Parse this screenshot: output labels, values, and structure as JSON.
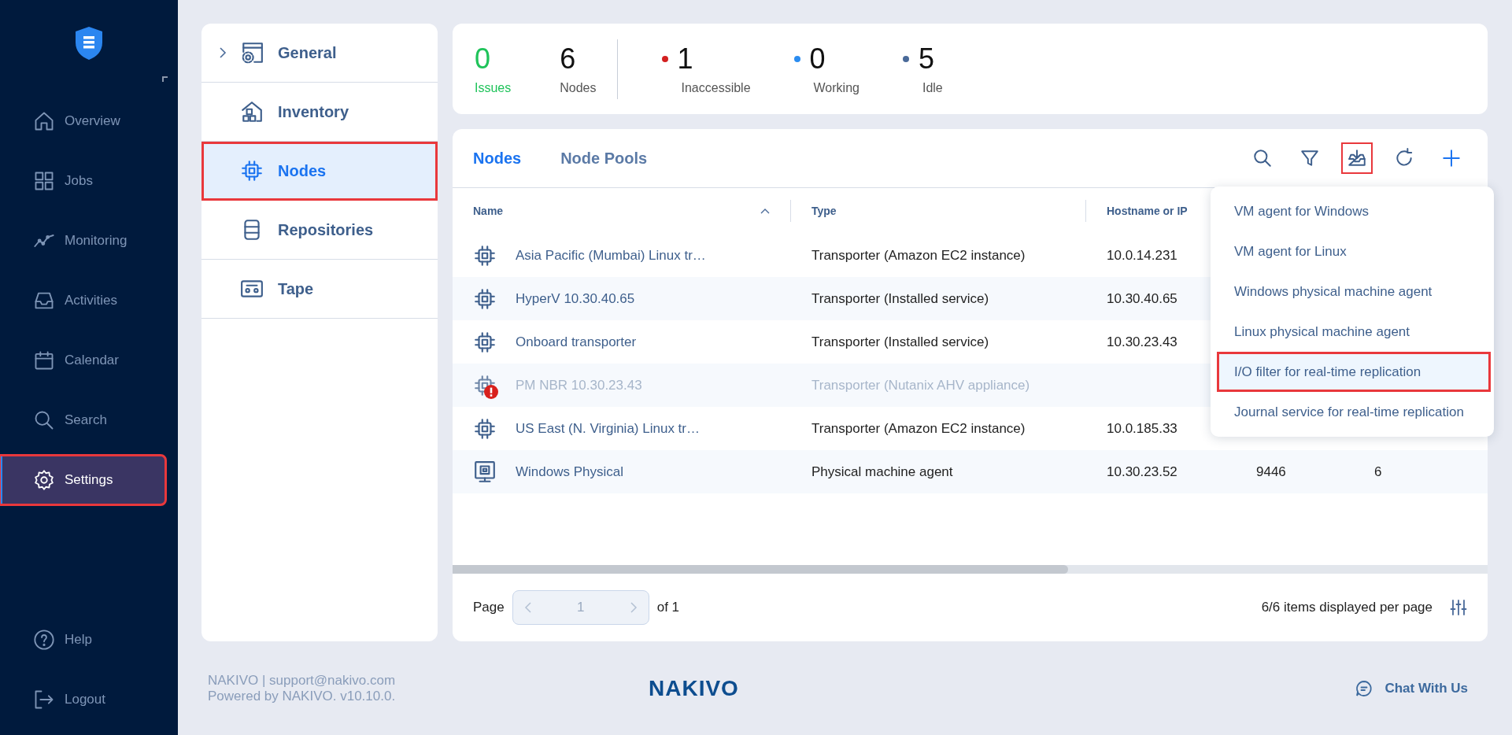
{
  "sidebar": {
    "items": [
      {
        "label": "Overview",
        "selected": false,
        "highlighted": false
      },
      {
        "label": "Jobs",
        "selected": false,
        "highlighted": false
      },
      {
        "label": "Monitoring",
        "selected": false,
        "highlighted": false
      },
      {
        "label": "Activities",
        "selected": false,
        "highlighted": false
      },
      {
        "label": "Calendar",
        "selected": false,
        "highlighted": false
      },
      {
        "label": "Search",
        "selected": false,
        "highlighted": false
      },
      {
        "label": "Settings",
        "selected": true,
        "highlighted": true
      }
    ],
    "bottom_items": [
      {
        "label": "Help"
      },
      {
        "label": "Logout"
      }
    ]
  },
  "settings_menu": {
    "items": [
      {
        "label": "General",
        "expandable": true,
        "selected": false,
        "highlighted": false
      },
      {
        "label": "Inventory",
        "expandable": false,
        "selected": false,
        "highlighted": false
      },
      {
        "label": "Nodes",
        "expandable": false,
        "selected": true,
        "highlighted": true
      },
      {
        "label": "Repositories",
        "expandable": false,
        "selected": false,
        "highlighted": false
      },
      {
        "label": "Tape",
        "expandable": false,
        "selected": false,
        "highlighted": false
      }
    ]
  },
  "summary": {
    "counts": [
      {
        "value": "0",
        "label": "Issues",
        "kind": "issues"
      },
      {
        "value": "6",
        "label": "Nodes",
        "kind": "plain"
      }
    ],
    "statuses": [
      {
        "value": "1",
        "label": "Inaccessible",
        "color": "#d32020"
      },
      {
        "value": "0",
        "label": "Working",
        "color": "#2b8cf0"
      },
      {
        "value": "5",
        "label": "Idle",
        "color": "#4a6a99"
      }
    ]
  },
  "tabs": [
    {
      "label": "Nodes",
      "selected": true
    },
    {
      "label": "Node Pools",
      "selected": false
    }
  ],
  "toolbar": [
    {
      "highlighted": false
    },
    {
      "highlighted": false
    },
    {
      "highlighted": true
    },
    {
      "highlighted": false
    },
    {
      "highlighted": false
    }
  ],
  "table": {
    "columns": [
      "Name",
      "Type",
      "Hostname or IP"
    ],
    "rows": [
      {
        "kind": "transporter",
        "name": "Asia Pacific (Mumbai) Linux tr…",
        "type": "Transporter (Amazon EC2 instance)",
        "host": "10.0.14.231",
        "disabled": false,
        "error": false
      },
      {
        "kind": "transporter",
        "name": "HyperV 10.30.40.65",
        "type": "Transporter (Installed service)",
        "host": "10.30.40.65",
        "disabled": false,
        "error": false
      },
      {
        "kind": "transporter",
        "name": "Onboard transporter",
        "type": "Transporter (Installed service)",
        "host": "10.30.23.43",
        "disabled": false,
        "error": false
      },
      {
        "kind": "transporter",
        "name": "PM NBR 10.30.23.43",
        "type": "Transporter (Nutanix AHV appliance)",
        "disabled": true,
        "error": true
      },
      {
        "kind": "transporter",
        "name": "US East (N. Virginia) Linux tr…",
        "type": "Transporter (Amazon EC2 instance)",
        "host": "10.0.185.33",
        "disabled": false,
        "error": false
      },
      {
        "kind": "physical",
        "name": "Windows Physical",
        "type": "Physical machine agent",
        "host": "10.30.23.52",
        "column_4": "9446",
        "column_5": "6",
        "disabled": false,
        "error": false
      }
    ]
  },
  "dropdown": {
    "items": [
      {
        "label": "VM agent for Windows",
        "highlighted": false
      },
      {
        "label": "VM agent for Linux",
        "highlighted": false
      },
      {
        "label": "Windows physical machine agent",
        "highlighted": false
      },
      {
        "label": "Linux physical machine agent",
        "highlighted": false
      },
      {
        "label": "I/O filter for real-time replication",
        "highlighted": true
      },
      {
        "label": "Journal service for real-time replication",
        "highlighted": false
      }
    ]
  },
  "pagination": {
    "page_label": "Page",
    "page": "1",
    "of": "of 1",
    "items_text": "6/6 items displayed per page"
  },
  "footer": {
    "line1": "NAKIVO | support@nakivo.com",
    "line2": "Powered by NAKIVO. v10.10.0.",
    "logo": "NAKIVO",
    "chat": "Chat With Us"
  }
}
